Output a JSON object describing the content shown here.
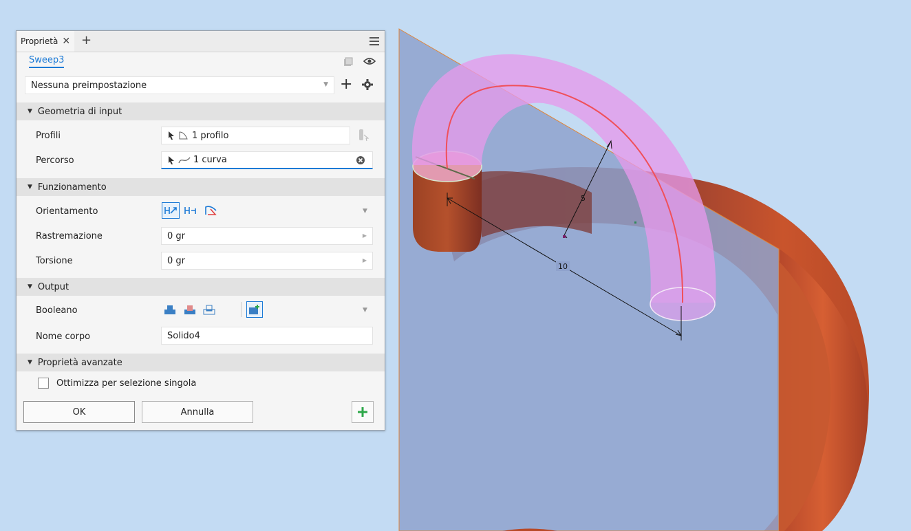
{
  "panel": {
    "tab_label": "Proprietà",
    "feature_name": "Sweep3",
    "preset": "Nessuna preimpostazione",
    "sections": {
      "input": "Geometria di input",
      "behavior": "Funzionamento",
      "output": "Output",
      "advanced": "Proprietà avanzate"
    },
    "rows": {
      "profiles_label": "Profili",
      "profiles_value": "1 profilo",
      "path_label": "Percorso",
      "path_value": "1 curva",
      "orientation_label": "Orientamento",
      "taper_label": "Rastremazione",
      "taper_value": "0 gr",
      "twist_label": "Torsione",
      "twist_value": "0 gr",
      "boolean_label": "Booleano",
      "body_name_label": "Nome corpo",
      "body_name_value": "Solido4"
    },
    "optimize_label": "Ottimizza per selezione singola",
    "optimize_checked": false,
    "ok_label": "OK",
    "cancel_label": "Annulla"
  },
  "viewport": {
    "dimension_path": "10",
    "dimension_radius": "5"
  },
  "colors": {
    "accent": "#1c7ad6",
    "background": "#c3dbf3",
    "plane": "#8fa2cc",
    "torus": "#c4532c",
    "sweep_preview": "#e59aea",
    "path_curve": "#f0505a",
    "add_green": "#2ea84a"
  }
}
